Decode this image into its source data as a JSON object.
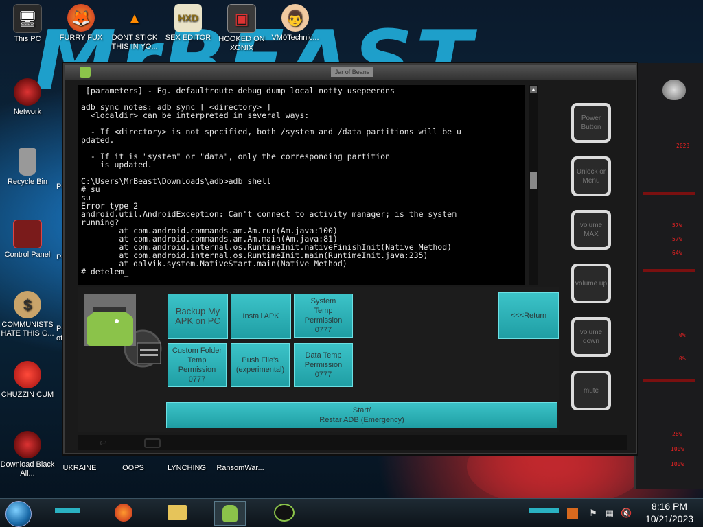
{
  "desktop_icons_top": [
    {
      "label": "This PC",
      "icon": "this-pc-icon"
    },
    {
      "label": "FURRY FUX",
      "icon": "firefox-icon"
    },
    {
      "label": "DONT STICK THIS IN YO...",
      "icon": "vlc-cone-icon"
    },
    {
      "label": "SEX EDITOR",
      "icon": "hxd-editor-icon"
    },
    {
      "label": "HOOKED ON XONIX",
      "icon": "game-icon"
    },
    {
      "label": "VM0Technic...",
      "icon": "doctor-icon"
    }
  ],
  "desktop_icons_left": [
    {
      "label": "Network",
      "icon": "network-icon"
    },
    {
      "label": "Recycle Bin",
      "icon": "recycle-bin-icon"
    },
    {
      "label": "Control Panel",
      "icon": "control-panel-icon"
    },
    {
      "label": "COMMUNISTS HATE THIS G...",
      "icon": "money-bag-icon"
    },
    {
      "label": "CHUZZIN CUM",
      "icon": "chuzzle-icon"
    },
    {
      "label": "Download Black Ali...",
      "icon": "alien-icon"
    }
  ],
  "desktop_partial_labels": [
    "Pe",
    "Pe",
    "Pe",
    "of"
  ],
  "desktop_icons_bottom": [
    {
      "label": "UKRAINE",
      "icon": "shortcut-icon"
    },
    {
      "label": "OOPS",
      "icon": "shortcut-icon"
    },
    {
      "label": "LYNCHING",
      "icon": "shortcut-icon"
    },
    {
      "label": "RansomWar...",
      "icon": "shortcut-icon"
    }
  ],
  "window": {
    "title": "Jar of Beans"
  },
  "terminal": {
    "lines": [
      " [parameters] - Eg. defaultroute debug dump local notty usepeerdns",
      "",
      "adb sync notes: adb sync [ <directory> ]",
      "  <localdir> can be interpreted in several ways:",
      "",
      "  - If <directory> is not specified, both /system and /data partitions will be u",
      "pdated.",
      "",
      "  - If it is \"system\" or \"data\", only the corresponding partition",
      "    is updated.",
      "",
      "C:\\Users\\MrBeast\\Downloads\\adb>adb shell",
      "# su",
      "su",
      "Error type 2",
      "android.util.AndroidException: Can't connect to activity manager; is the system",
      "running?",
      "        at com.android.commands.am.Am.run(Am.java:100)",
      "        at com.android.commands.am.Am.main(Am.java:81)",
      "        at com.android.internal.os.RuntimeInit.nativeFinishInit(Native Method)",
      "        at com.android.internal.os.RuntimeInit.main(RuntimeInit.java:235)",
      "        at dalvik.system.NativeStart.main(Native Method)",
      "# detelem_"
    ]
  },
  "tools": {
    "backup": "Backup My APK on PC",
    "install": "Install APK",
    "system_temp": "System Temp Permission 0777",
    "custom_folder": "Custom Folder Temp Permission 0777",
    "push_files": "Push File's (experimental)",
    "data_temp": "Data Temp Permission 0777",
    "return": "<<<Return",
    "start": "Start/",
    "restart": "Restar ADB (Emergency)"
  },
  "right_buttons": [
    "Power Button",
    "Unlock or Menu",
    "volume MAX",
    "volume up",
    "volume down",
    "mute"
  ],
  "side_percentages": [
    "57%",
    "57%",
    "64%",
    "0%",
    "0%",
    "28%",
    "100%",
    "100%"
  ],
  "side_header": "2023",
  "clock": {
    "time": "8:16 PM",
    "date": "10/21/2023"
  },
  "colors": {
    "accent": "#2bb7bd",
    "wallpaper_text": "#22b6e6",
    "gauge_red": "#e22222"
  }
}
